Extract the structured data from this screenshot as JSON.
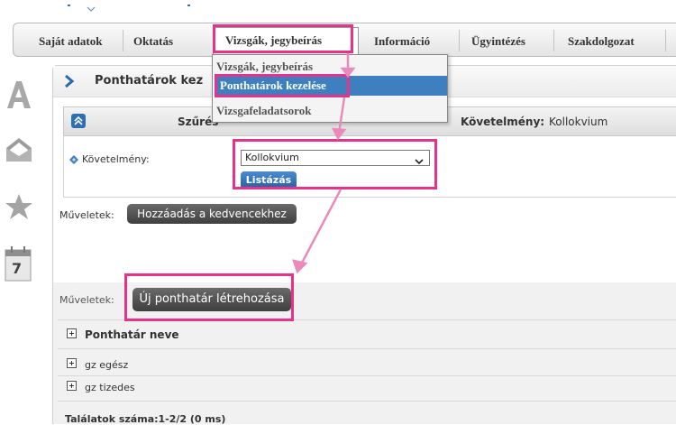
{
  "nav": {
    "items": [
      "Saját adatok",
      "Oktatás",
      "Vizsgák, jegybeírás",
      "Információ",
      "Ügyintézés",
      "Szakdolgozat"
    ],
    "active": "Vizsgák, jegybeírás"
  },
  "dropdown": {
    "items": [
      "Vizsgák, jegybeírás",
      "Ponthatárok kezelése",
      "Vizsgafeladatsorok"
    ],
    "selected": "Ponthatárok kezelése"
  },
  "panel": {
    "title": "Ponthatárok kez",
    "filter_title": "Szűrés",
    "filter_title_partial": "Szűrés",
    "requirement_summary_label": "Követelmény:",
    "requirement_summary_value": "Kollokvium"
  },
  "filter": {
    "requirement_label": "Követelmény:",
    "requirement_value": "Kollokvium",
    "list_button": "Listázás"
  },
  "operations_top": {
    "label": "Műveletek:",
    "button": "Hozzáadás a kedvencekhez"
  },
  "operations_bottom": {
    "label": "Műveletek:",
    "button": "Új ponthatár létrehozása"
  },
  "table": {
    "header": "Ponthatár neve",
    "rows": [
      "gz egész",
      "gz tizedes"
    ],
    "footer": "Találatok száma:1-2/2 (0 ms)"
  },
  "left_icons": {
    "calendar_day": "7"
  },
  "colors": {
    "highlight": "#e5328b",
    "menu_selected": "#3d7fbf",
    "button_blue": "#2e6fb3"
  }
}
